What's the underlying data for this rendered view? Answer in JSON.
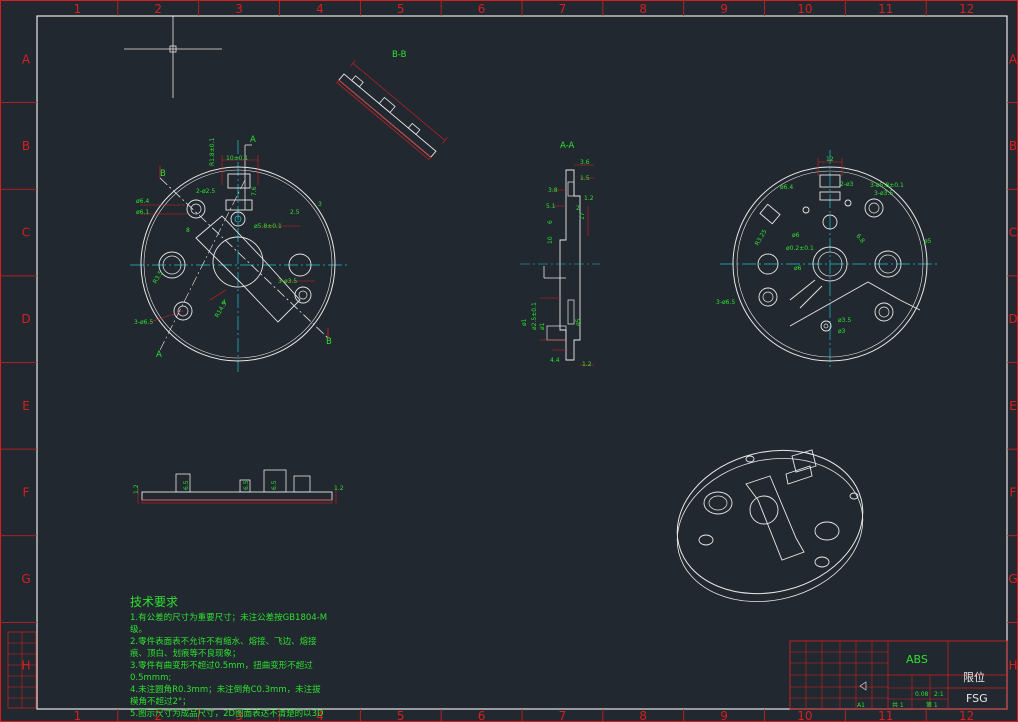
{
  "frame": {
    "columns": [
      "1",
      "2",
      "3",
      "4",
      "5",
      "6",
      "7",
      "8",
      "9",
      "10",
      "11",
      "12"
    ],
    "rows": [
      "A",
      "B",
      "C",
      "D",
      "E",
      "F",
      "G",
      "H"
    ]
  },
  "views": {
    "section_bb": "B-B",
    "section_aa": "A-A",
    "cut_a": "A",
    "cut_b": "B"
  },
  "front_view_dims": [
    "R1.8±0.1",
    "10±0.1",
    "2-ø2.5",
    "ø6.4",
    "ø6.1",
    "ø5.8±0.1",
    "3-ø3.5",
    "R14.5",
    "3-ø6.5",
    "7.6",
    "2.5",
    "3",
    "8",
    "4",
    "R3.5"
  ],
  "section_aa_dims": [
    "3.6",
    "1.5",
    "3.8",
    "5.1",
    "1.2",
    "2",
    "6",
    "10",
    "17",
    "ø2.5±0.1",
    "ø1",
    "ø1",
    "ø5",
    "4.4",
    "1.2"
  ],
  "back_view_dims": [
    "12",
    "2-ø3",
    "3-ø5.8±0.1",
    "3-ø3.5",
    "ø6.4",
    "ø6",
    "ø0.2±0.1",
    "ø6",
    "ø5",
    "R3.25",
    "3-ø6.5",
    "ø3.5",
    "ø3",
    "6.8"
  ],
  "side_view_dims": [
    "1.2",
    "6.5",
    "6.5",
    "6.5",
    "1.2"
  ],
  "notes": {
    "title": "技术要求",
    "lines": [
      "1.有公差的尺寸为重要尺寸；未注公差按GB1804-M",
      "级。",
      "2.零件表面表不允许不有缩水、熔接、飞边、熔接",
      "痕、顶白、划痕等不良现象；",
      "3.零件有曲变形不超过0.5mm，扭曲变形不超过",
      "0.5mmm;",
      "4.未注圆角R0.3mm；未注倒角C0.3mm，未注拔",
      "模角不超过2°；",
      "5.图示尺寸为成品尺寸，2D图面表达不清楚的以3D"
    ]
  },
  "title_block": {
    "material": "ABS",
    "part_name": "限位",
    "part_code": "FSG",
    "sheet_size": "A1",
    "scale_ratio": "2:1",
    "weight": "0.08",
    "sheets_total": "共 1",
    "sheet_no": "第 1"
  }
}
